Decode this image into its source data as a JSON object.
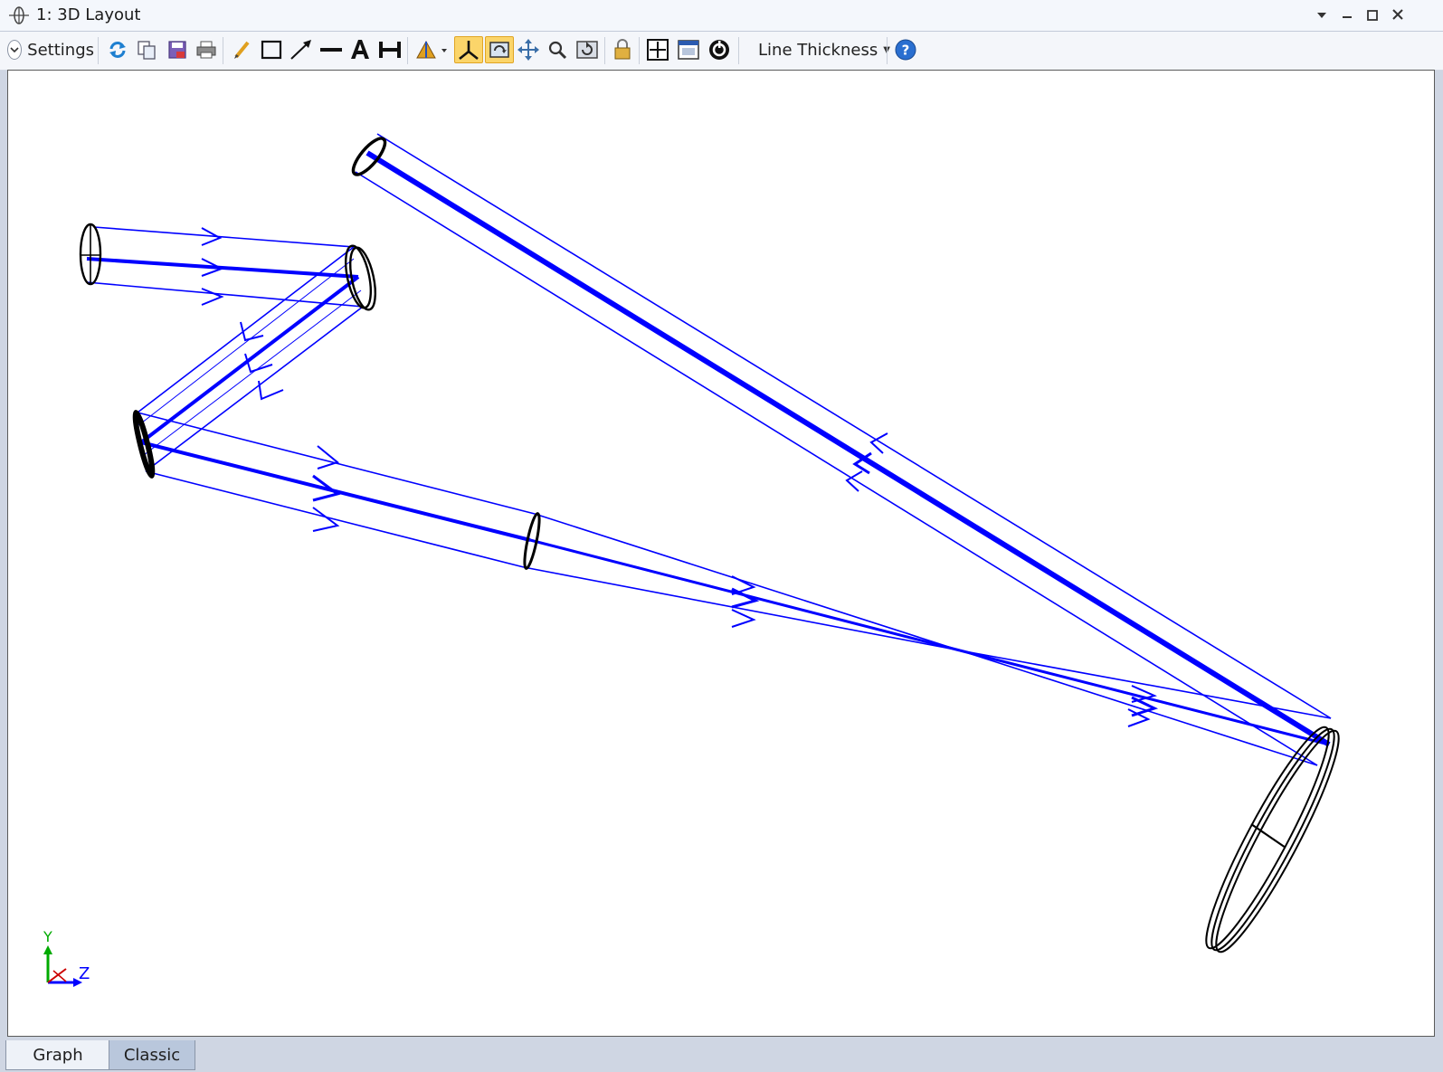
{
  "window": {
    "title": "1: 3D Layout",
    "icon": "lens-icon"
  },
  "toolbar": {
    "settings_label": "Settings",
    "line_thickness_label": "Line Thickness",
    "icons": [
      "refresh-icon",
      "copy-icon",
      "save-icon",
      "print-icon",
      "pencil-icon",
      "rectangle-icon",
      "arrow-icon",
      "line-icon",
      "text-icon",
      "dimension-icon",
      "rotate-axis-icon",
      "axes-icon",
      "auto-rotate-icon",
      "pan-icon",
      "zoom-icon",
      "reset-view-icon",
      "lock-icon",
      "fit-icon",
      "window-icon",
      "layer-icon",
      "help-icon"
    ]
  },
  "axes_indicator": {
    "y_label": "Y",
    "z_label": "Z"
  },
  "tabs": [
    {
      "label": "Graph",
      "active": true
    },
    {
      "label": "Classic",
      "active": false
    }
  ],
  "colors": {
    "ray": "#0000ff",
    "lens": "#000000",
    "axis_y": "#00aa00",
    "axis_z": "#0000ff",
    "axis_x": "#cc0000",
    "active_button": "#fbd56a"
  }
}
